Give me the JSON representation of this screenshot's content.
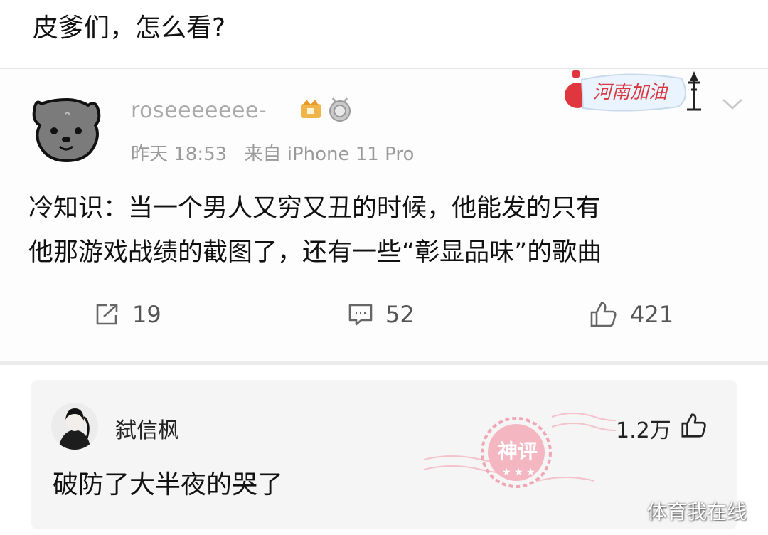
{
  "post": {
    "title": "皮爹们，怎么看?"
  },
  "weibo": {
    "username": "roseeeeeee-",
    "time": "昨天 18:53",
    "source": "来自 iPhone 11 Pro",
    "campaign_sticker": "河南加油",
    "body_line1": "冷知识：当一个男人又穷又丑的时候，他能发的只有",
    "body_line2": "他那游戏战绩的截图了，还有一些“彰显品味”的歌曲",
    "reposts": "19",
    "comments": "52",
    "likes": "421",
    "icons": [
      "bear-avatar-icon",
      "crown-badge-icon",
      "level-badge-icon",
      "chevron-down-icon",
      "repost-icon",
      "comment-icon",
      "like-icon"
    ]
  },
  "top_comment": {
    "username": "弑信枫",
    "likes": "1.2万",
    "text": "破防了大半夜的哭了",
    "stamp": "神评"
  },
  "watermark": "体育我在线",
  "colors": {
    "stamp": "#f0a7b4",
    "sticker_red": "#d9363e",
    "meta_gray": "#9a9a9a"
  }
}
